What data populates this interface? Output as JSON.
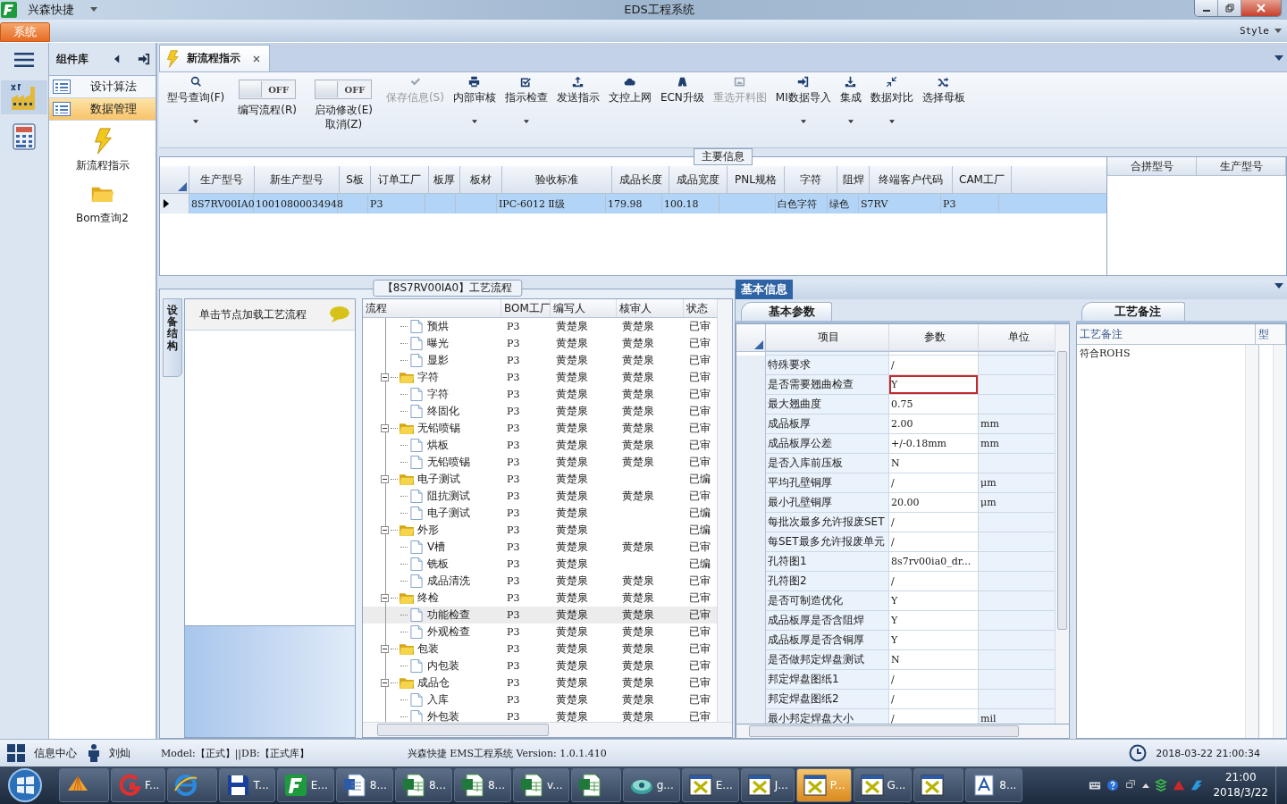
{
  "window": {
    "app_name": "兴森快捷",
    "title": "EDS工程系统",
    "style_label": "Style"
  },
  "menu": [
    {
      "label": "系统",
      "selected": true
    }
  ],
  "sidebar": {
    "title": "组件库",
    "items": [
      {
        "label": "设计算法",
        "selected": false
      },
      {
        "label": "数据管理",
        "selected": true
      }
    ],
    "launchers": [
      {
        "label": "新流程指示"
      },
      {
        "label": "Bom查询2"
      }
    ]
  },
  "tab": {
    "label": "新流程指示"
  },
  "toolbar": [
    {
      "kind": "button",
      "label": "型号查询(F)",
      "dropdown": true,
      "disabled": false
    },
    {
      "kind": "toggle",
      "on": false,
      "state_text": "OFF",
      "label": "编写流程(R)"
    },
    {
      "kind": "toggle",
      "on": false,
      "state_text": "OFF",
      "label": "启动修改(E)",
      "sublabel": "取消(Z)"
    },
    {
      "kind": "button",
      "label": "保存信息(S)",
      "dropdown": false,
      "disabled": true
    },
    {
      "kind": "button",
      "label": "内部审核",
      "dropdown": true,
      "disabled": false
    },
    {
      "kind": "button",
      "label": "指示检查",
      "dropdown": true,
      "disabled": false
    },
    {
      "kind": "button",
      "label": "发送指示",
      "dropdown": false,
      "disabled": false
    },
    {
      "kind": "button",
      "label": "文控上网",
      "dropdown": false,
      "disabled": false
    },
    {
      "kind": "button",
      "label": "ECN升级",
      "dropdown": false,
      "disabled": false
    },
    {
      "kind": "button",
      "label": "重选开料图",
      "dropdown": false,
      "disabled": true
    },
    {
      "kind": "button",
      "label": "MI数据导入",
      "dropdown": true,
      "disabled": false
    },
    {
      "kind": "button",
      "label": "集成",
      "dropdown": true,
      "disabled": false
    },
    {
      "kind": "button",
      "label": "数据对比",
      "dropdown": true,
      "disabled": false
    },
    {
      "kind": "button",
      "label": "选择母板",
      "dropdown": false,
      "disabled": false
    }
  ],
  "main_info": {
    "title": "主要信息",
    "columns": [
      "生产型号",
      "新生产型号",
      "S板",
      "订单工厂",
      "板厚",
      "板材",
      "验收标准",
      "成品长度",
      "成品宽度",
      "PNL规格",
      "字符",
      "阻焊",
      "终端客户代码",
      "CAM工厂"
    ],
    "rows": [
      {
        "selected": true,
        "cells": [
          "8S7RV00IA0",
          "10010800034948",
          null,
          "P3",
          null,
          null,
          "IPC-6012 Ⅱ级",
          "179.98",
          "100.18",
          null,
          "白色字符",
          "绿色",
          "S7RV",
          "P3"
        ]
      }
    ],
    "side_columns": [
      "合拼型号",
      "生产型号"
    ]
  },
  "process": {
    "title": "【8S7RV00IA0】工艺流程",
    "side_tab": "设备结构",
    "hint": "单击节点加载工艺流程",
    "columns": [
      "流程",
      "BOM工厂",
      "编写人",
      "核审人",
      "状态"
    ],
    "tree": [
      {
        "kind": "file",
        "name": "预烘",
        "bom": "P3",
        "writer": "黄楚泉",
        "reviewer": "黄楚泉",
        "status": "已审",
        "selected": false
      },
      {
        "kind": "file",
        "name": "曝光",
        "bom": "P3",
        "writer": "黄楚泉",
        "reviewer": "黄楚泉",
        "status": "已审",
        "selected": false
      },
      {
        "kind": "file",
        "name": "显影",
        "bom": "P3",
        "writer": "黄楚泉",
        "reviewer": "黄楚泉",
        "status": "已审",
        "selected": false
      },
      {
        "kind": "folder",
        "name": "字符",
        "bom": "P3",
        "writer": "黄楚泉",
        "reviewer": "黄楚泉",
        "status": "已审",
        "selected": false,
        "expanded": true,
        "children": [
          {
            "kind": "file",
            "name": "字符",
            "bom": "P3",
            "writer": "黄楚泉",
            "reviewer": "黄楚泉",
            "status": "已审",
            "selected": false
          },
          {
            "kind": "file",
            "name": "终固化",
            "bom": "P3",
            "writer": "黄楚泉",
            "reviewer": "黄楚泉",
            "status": "已审",
            "selected": false
          }
        ]
      },
      {
        "kind": "folder",
        "name": "无铅喷锡",
        "bom": "P3",
        "writer": "黄楚泉",
        "reviewer": "黄楚泉",
        "status": "已审",
        "selected": false,
        "expanded": true,
        "children": [
          {
            "kind": "file",
            "name": "烘板",
            "bom": "P3",
            "writer": "黄楚泉",
            "reviewer": "黄楚泉",
            "status": "已审",
            "selected": false
          },
          {
            "kind": "file",
            "name": "无铅喷锡",
            "bom": "P3",
            "writer": "黄楚泉",
            "reviewer": "黄楚泉",
            "status": "已审",
            "selected": false
          }
        ]
      },
      {
        "kind": "folder",
        "name": "电子测试",
        "bom": "P3",
        "writer": "黄楚泉",
        "status": "已编",
        "selected": false,
        "expanded": true,
        "children": [
          {
            "kind": "file",
            "name": "阻抗测试",
            "bom": "P3",
            "writer": "黄楚泉",
            "reviewer": "黄楚泉",
            "status": "已审",
            "selected": false
          },
          {
            "kind": "file",
            "name": "电子测试",
            "bom": "P3",
            "writer": "黄楚泉",
            "status": "已编",
            "selected": false
          }
        ]
      },
      {
        "kind": "folder",
        "name": "外形",
        "bom": "P3",
        "writer": "黄楚泉",
        "status": "已编",
        "selected": false,
        "expanded": true,
        "children": [
          {
            "kind": "file",
            "name": "V槽",
            "bom": "P3",
            "writer": "黄楚泉",
            "reviewer": "黄楚泉",
            "status": "已审",
            "selected": false
          },
          {
            "kind": "file",
            "name": "铣板",
            "bom": "P3",
            "writer": "黄楚泉",
            "status": "已编",
            "selected": false
          },
          {
            "kind": "file",
            "name": "成品清洗",
            "bom": "P3",
            "writer": "黄楚泉",
            "reviewer": "黄楚泉",
            "status": "已审",
            "selected": false
          }
        ]
      },
      {
        "kind": "folder",
        "name": "终检",
        "bom": "P3",
        "writer": "黄楚泉",
        "reviewer": "黄楚泉",
        "status": "已审",
        "selected": false,
        "expanded": true,
        "children": [
          {
            "kind": "file",
            "name": "功能检查",
            "bom": "P3",
            "writer": "黄楚泉",
            "reviewer": "黄楚泉",
            "status": "已审",
            "selected": true
          },
          {
            "kind": "file",
            "name": "外观检查",
            "bom": "P3",
            "writer": "黄楚泉",
            "reviewer": "黄楚泉",
            "status": "已审",
            "selected": false
          }
        ]
      },
      {
        "kind": "folder",
        "name": "包装",
        "bom": "P3",
        "writer": "黄楚泉",
        "reviewer": "黄楚泉",
        "status": "已审",
        "selected": false,
        "expanded": true,
        "children": [
          {
            "kind": "file",
            "name": "内包装",
            "bom": "P3",
            "writer": "黄楚泉",
            "reviewer": "黄楚泉",
            "status": "已审",
            "selected": false
          }
        ]
      },
      {
        "kind": "folder",
        "name": "成品仓",
        "bom": "P3",
        "writer": "黄楚泉",
        "reviewer": "黄楚泉",
        "status": "已审",
        "selected": false,
        "expanded": true,
        "children": [
          {
            "kind": "file",
            "name": "入库",
            "bom": "P3",
            "writer": "黄楚泉",
            "reviewer": "黄楚泉",
            "status": "已审",
            "selected": false
          },
          {
            "kind": "file",
            "name": "外包装",
            "bom": "P3",
            "writer": "黄楚泉",
            "reviewer": "黄楚泉",
            "status": "已审",
            "selected": false
          }
        ]
      }
    ]
  },
  "basic": {
    "tab": "基本信息",
    "subtab": "基本参数",
    "columns": [
      "项目",
      "参数",
      "单位"
    ],
    "rows": [
      {
        "item": "特殊要求",
        "value": "/",
        "selected": false
      },
      {
        "item": "是否需要翘曲检查",
        "value": "Y",
        "selected": true
      },
      {
        "item": "最大翘曲度",
        "value": "0.75",
        "selected": false
      },
      {
        "item": "成品板厚",
        "value": "2.00",
        "unit": "mm",
        "selected": false
      },
      {
        "item": "成品板厚公差",
        "value": "+/-0.18mm",
        "unit": "mm",
        "selected": false
      },
      {
        "item": "是否入库前压板",
        "value": "N",
        "selected": false
      },
      {
        "item": "平均孔壁铜厚",
        "value": "/",
        "unit": "μm",
        "selected": false
      },
      {
        "item": "最小孔壁铜厚",
        "value": "20.00",
        "unit": "μm",
        "selected": false
      },
      {
        "item": "每批次最多允许报废SET",
        "value": "/",
        "selected": false
      },
      {
        "item": "每SET最多允许报废单元",
        "value": "/",
        "selected": false
      },
      {
        "item": "孔符图1",
        "value": "8s7rv00ia0_dr...",
        "selected": false
      },
      {
        "item": "孔符图2",
        "value": "/",
        "selected": false
      },
      {
        "item": "是否可制造优化",
        "value": "Y",
        "selected": false
      },
      {
        "item": "成品板厚是否含阻焊",
        "value": "Y",
        "selected": false
      },
      {
        "item": "成品板厚是否含铜厚",
        "value": "Y",
        "selected": false
      },
      {
        "item": "是否做邦定焊盘测试",
        "value": "N",
        "selected": false
      },
      {
        "item": "邦定焊盘图纸1",
        "value": "/",
        "selected": false
      },
      {
        "item": "邦定焊盘图纸2",
        "value": "/",
        "selected": false
      },
      {
        "item": "最小邦定焊盘大小",
        "value": "/",
        "unit": "mil",
        "selected": false
      }
    ]
  },
  "notes": {
    "tab": "工艺备注",
    "columns": [
      "工艺备注",
      "型"
    ],
    "text": "符合ROHS"
  },
  "status_bar": {
    "info_center": "信息中心",
    "user": "刘灿",
    "model": "Model:【正式】||DB:【正式库】",
    "app": "兴森快捷 EMS工程系统 Version: 1.0.1.410",
    "datetime": "2018-03-22 21:00:34"
  },
  "taskbar": {
    "items": [
      {
        "selected": false
      },
      {
        "label": "F...",
        "selected": false
      },
      {
        "selected": false
      },
      {
        "label": "T...",
        "selected": false
      },
      {
        "label": "E...",
        "selected": false
      },
      {
        "label": "8...",
        "selected": false
      },
      {
        "label": "8...",
        "selected": false
      },
      {
        "label": "8...",
        "selected": false
      },
      {
        "label": "v...",
        "selected": false
      },
      {
        "selected": false
      },
      {
        "label": "g...",
        "selected": false
      },
      {
        "label": "E...",
        "selected": false
      },
      {
        "label": "J...",
        "selected": false
      },
      {
        "label": "P...",
        "selected": true
      },
      {
        "label": "G...",
        "selected": false
      },
      {
        "selected": false
      },
      {
        "label": "8...",
        "selected": false
      }
    ],
    "time": "21:00",
    "date": "2018/3/22"
  }
}
